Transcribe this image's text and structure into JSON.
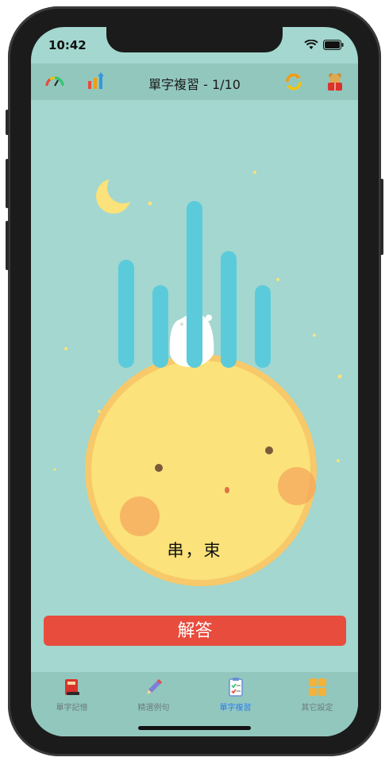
{
  "status_bar": {
    "time": "10:42"
  },
  "nav": {
    "title": "單字複習 - 1/10",
    "left_icons": [
      "speed-gauge-icon",
      "stats-arrows-icon"
    ],
    "right_icons": [
      "refresh-icon",
      "reading-bear-icon"
    ]
  },
  "card": {
    "word": "串，束"
  },
  "answer_button": {
    "label": "解答"
  },
  "tabs": [
    {
      "label": "單字記憶",
      "icon": "book-icon",
      "active": false
    },
    {
      "label": "精選例句",
      "icon": "pencil-icon",
      "active": false
    },
    {
      "label": "單字複習",
      "icon": "checklist-icon",
      "active": true
    },
    {
      "label": "其它設定",
      "icon": "grid-icon",
      "active": false
    }
  ],
  "colors": {
    "background": "#a3d7cf",
    "bar": "#5bcbdb",
    "moon": "#fbe27a",
    "answer": "#e84c3d",
    "tab_active": "#2f7fe8"
  }
}
